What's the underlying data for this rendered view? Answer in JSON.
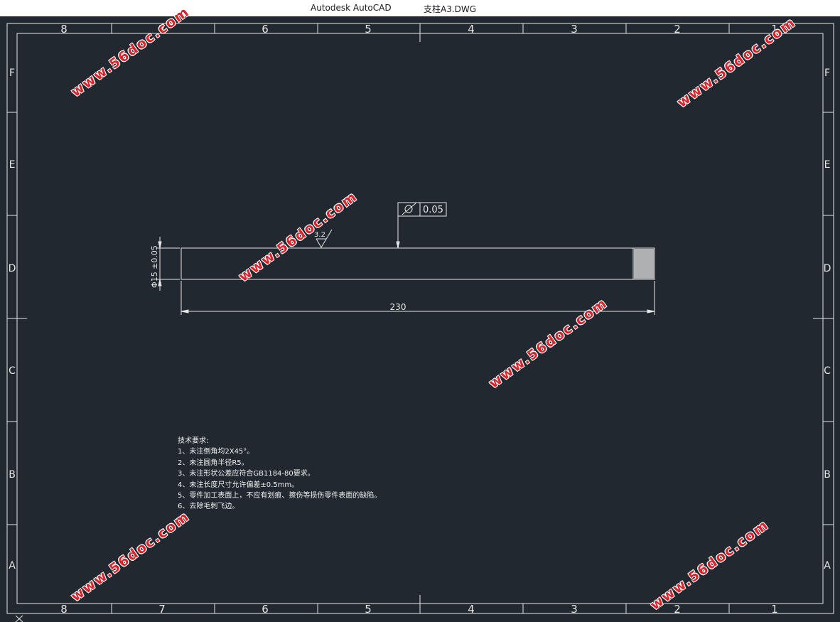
{
  "window": {
    "app_title": "Autodesk AutoCAD",
    "file_name": "支柱A3.DWG"
  },
  "frame": {
    "columns": [
      "8",
      "7",
      "6",
      "5",
      "4",
      "3",
      "2",
      "1"
    ],
    "rows": [
      "F",
      "E",
      "D",
      "C",
      "B",
      "A"
    ]
  },
  "drawing": {
    "length_dim": "230",
    "diameter_dim": "Φ15 ±0.05",
    "roughness": "3.2",
    "tolerance_value": "0.05"
  },
  "notes": {
    "title": "技术要求:",
    "lines": [
      "1、未注倒角均2X45°。",
      "2、未注圆角半径R5。",
      "3、未注形状公差应符合GB1184-80要求。",
      "4、未注长度尺寸允许偏差±0.5mm。",
      "5、零件加工表面上，不应有划痕、擦伤等损伤零件表面的缺陷。",
      "6、去除毛刺飞边。"
    ]
  },
  "watermark": {
    "text": "www.56doc.com"
  },
  "colors": {
    "background": "#212830",
    "line": "#e6e6e6",
    "watermark": "#d9242c"
  }
}
